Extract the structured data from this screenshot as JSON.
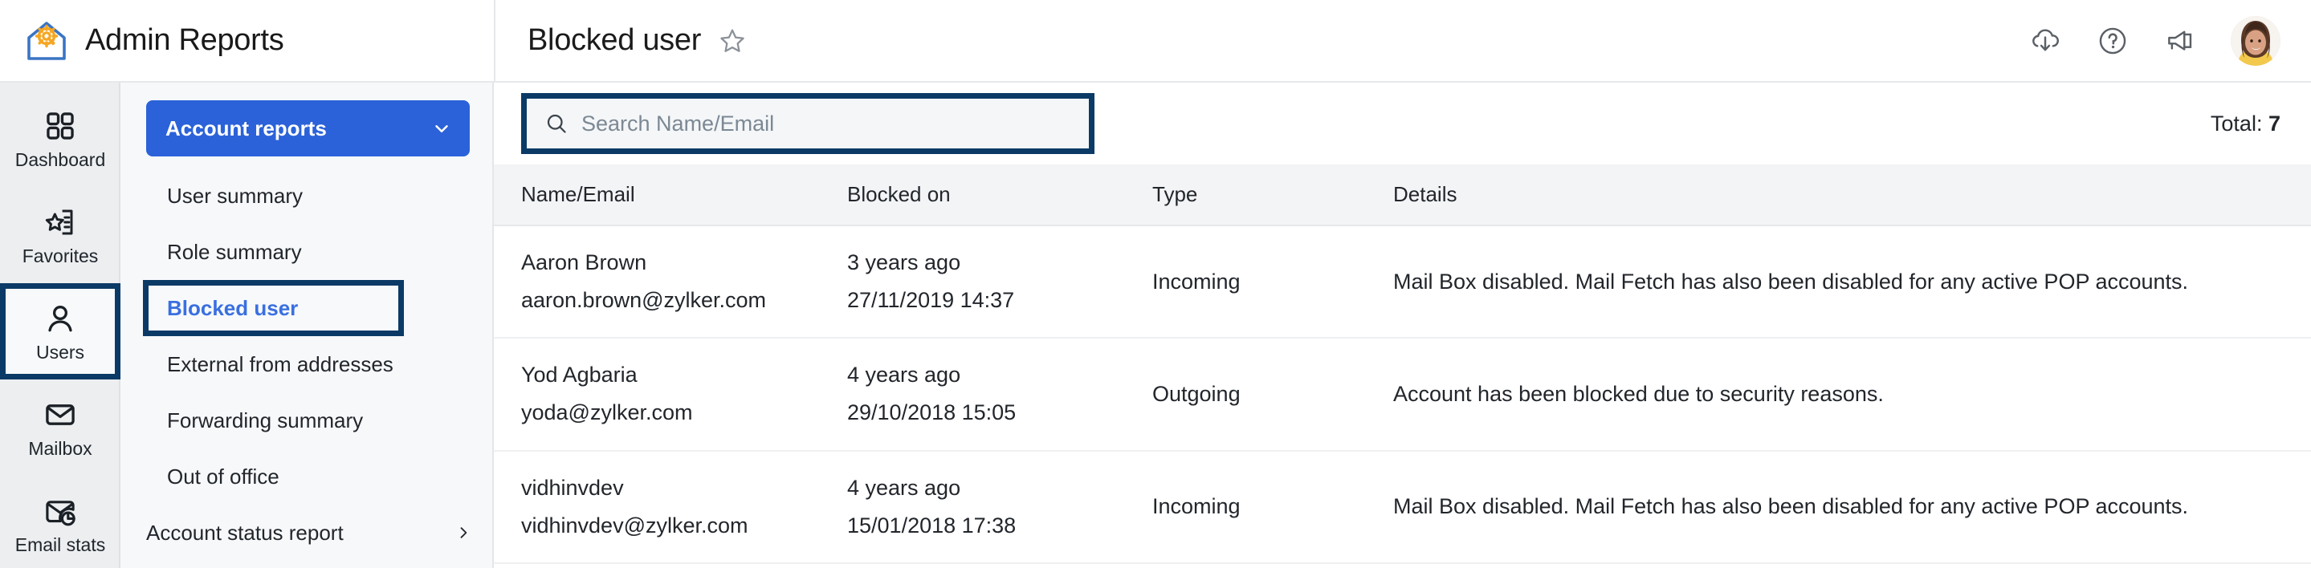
{
  "app": {
    "logo_icon": "home-gear-icon",
    "title": "Admin Reports"
  },
  "header": {
    "page_title": "Blocked user",
    "favorite_icon": "star-outline-icon",
    "actions": [
      {
        "name": "download-icon",
        "label": "Download"
      },
      {
        "name": "help-icon",
        "label": "Help"
      },
      {
        "name": "announcement-icon",
        "label": "What's new"
      }
    ],
    "avatar": {
      "name": "user-avatar",
      "label": "Account"
    }
  },
  "rail": {
    "items": [
      {
        "label": "Dashboard",
        "icon": "grid-icon",
        "selected": false
      },
      {
        "label": "Favorites",
        "icon": "star-list-icon",
        "selected": false
      },
      {
        "label": "Users",
        "icon": "person-icon",
        "selected": true
      },
      {
        "label": "Mailbox",
        "icon": "envelope-icon",
        "selected": false
      },
      {
        "label": "Email stats",
        "icon": "mail-chart-icon",
        "selected": false
      }
    ]
  },
  "subnav": {
    "group_label": "Account reports",
    "group_chevron": "chevron-down-icon",
    "items": [
      {
        "label": "User summary",
        "selected": false,
        "has_arrow": false,
        "root": false
      },
      {
        "label": "Role summary",
        "selected": false,
        "has_arrow": false,
        "root": false
      },
      {
        "label": "Blocked user",
        "selected": true,
        "has_arrow": false,
        "root": false
      },
      {
        "label": "External from addresses",
        "selected": false,
        "has_arrow": false,
        "root": false
      },
      {
        "label": "Forwarding summary",
        "selected": false,
        "has_arrow": false,
        "root": false
      },
      {
        "label": "Out of office",
        "selected": false,
        "has_arrow": false,
        "root": false
      },
      {
        "label": "Account status report",
        "selected": false,
        "has_arrow": true,
        "root": true
      }
    ]
  },
  "toolbar": {
    "search_placeholder": "Search Name/Email",
    "search_value": "",
    "search_icon": "search-icon",
    "total_label": "Total:",
    "total_value": "7"
  },
  "table": {
    "columns": [
      "Name/Email",
      "Blocked on",
      "Type",
      "Details"
    ],
    "rows": [
      {
        "name": "Aaron Brown",
        "email": "aaron.brown@zylker.com",
        "blocked_relative": "3 years ago",
        "blocked_absolute": "27/11/2019 14:37",
        "type": "Incoming",
        "details": "Mail Box disabled. Mail Fetch has also been disabled for any active POP accounts."
      },
      {
        "name": "Yod Agbaria",
        "email": "yoda@zylker.com",
        "blocked_relative": "4 years ago",
        "blocked_absolute": "29/10/2018 15:05",
        "type": "Outgoing",
        "details": "Account has been blocked due to security reasons."
      },
      {
        "name": "vidhinvdev",
        "email": "vidhinvdev@zylker.com",
        "blocked_relative": "4 years ago",
        "blocked_absolute": "15/01/2018 17:38",
        "type": "Incoming",
        "details": "Mail Box disabled. Mail Fetch has also been disabled for any active POP accounts."
      }
    ]
  },
  "colors": {
    "accent_blue": "#2b62d9",
    "link_blue": "#3a6fe0",
    "focus_navy": "#0b3a66",
    "logo_blue": "#3a74c4",
    "logo_orange": "#f5a623",
    "rail_bg": "#eceef0",
    "subnav_bg": "#f6f8fa",
    "table_header_bg": "#f2f4f6"
  }
}
